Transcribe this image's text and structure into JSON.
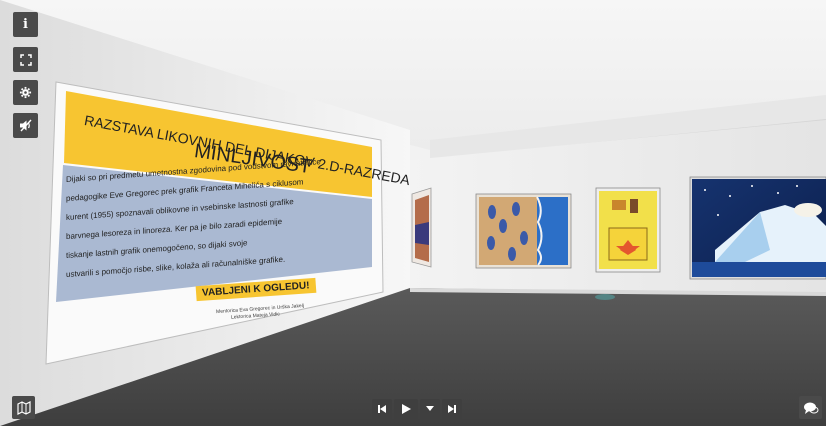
{
  "poster": {
    "title_line1": "RAZSTAVA LIKOVNIH DEL DIJAKOV 2.D-RAZREDA",
    "title_line2": "MINLJIVOST",
    "body_lines": [
      "Dijaki so pri predmetu umetnostna zgodovina pod vodstvom ravnateljice",
      "pedagogike Eve Gregorec prek grafik Franceta Mihelića s ciklusom",
      "kurent (1955) spoznavali oblikovne in vsebinske lastnosti grafike",
      "barvnega lesoreza in linoreza. Ker pa je bilo zaradi epidemije",
      "tiskanje lastnih grafik onemogočeno, so dijaki svoje",
      "ustvarili s pomočjo risbe, slike, kolaža ali računalniške grafike."
    ],
    "welcome": "VABLJENI K OGLEDU!",
    "footer_line1": "Mentorica Eva Gregorec in Urška Jakelj",
    "footer_line2": "Lektorica Mateja Vidic"
  },
  "controls": {
    "info": "i",
    "fullscreen_icon": "fullscreen-icon",
    "settings_icon": "gear-icon",
    "sound_icon": "mute-icon",
    "map_icon": "map-icon",
    "chat_icon": "chat-icon"
  },
  "playback": {
    "prev_icon": "skip-back-icon",
    "play_icon": "play-icon",
    "menu_icon": "chevron-down-icon",
    "next_icon": "skip-forward-icon"
  },
  "colors": {
    "poster_yellow": "#f7c531",
    "poster_blue": "#aab9d2",
    "floor": "#4f4f4f",
    "wall": "#f0f0f0",
    "control_bg": "#4a4a4a"
  }
}
